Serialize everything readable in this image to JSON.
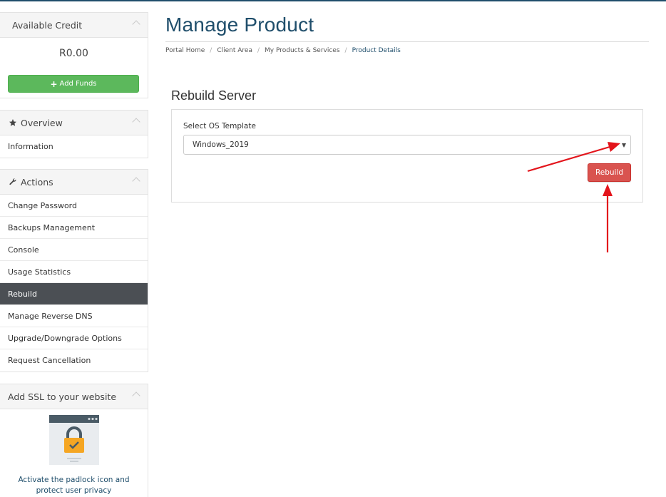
{
  "sidebar": {
    "credit": {
      "heading": "Available Credit",
      "amount": "R0.00",
      "add_funds_label": "Add Funds"
    },
    "overview": {
      "heading": "Overview",
      "items": [
        {
          "label": "Information"
        }
      ]
    },
    "actions": {
      "heading": "Actions",
      "items": [
        {
          "label": "Change Password"
        },
        {
          "label": "Backups Management"
        },
        {
          "label": "Console"
        },
        {
          "label": "Usage Statistics"
        },
        {
          "label": "Rebuild",
          "active": true
        },
        {
          "label": "Manage Reverse DNS"
        },
        {
          "label": "Upgrade/Downgrade Options"
        },
        {
          "label": "Request Cancellation"
        }
      ]
    },
    "ssl": {
      "heading": "Add SSL to your website",
      "text": "Activate the padlock icon and protect user privacy"
    }
  },
  "main": {
    "title": "Manage Product",
    "breadcrumb": [
      "Portal Home",
      "Client Area",
      "My Products & Services",
      "Product Details"
    ],
    "section_title": "Rebuild Server",
    "os_field": {
      "label": "Select OS Template",
      "value": "Windows_2019"
    },
    "rebuild_label": "Rebuild"
  },
  "colors": {
    "accent": "#1f4e6b",
    "add_funds": "#5cb85c",
    "rebuild": "#d9534f",
    "active_nav": "#4b4f54",
    "annotation_arrow": "#e3141b"
  }
}
